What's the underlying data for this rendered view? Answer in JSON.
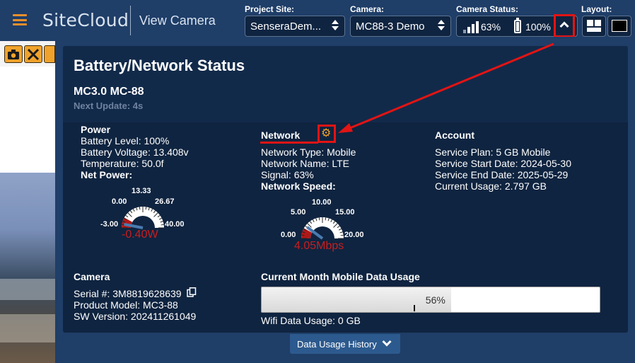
{
  "header": {
    "logo": "SiteCloud",
    "page_title": "View Camera",
    "project_site": {
      "label": "Project Site:",
      "value": "SenseraDem..."
    },
    "camera": {
      "label": "Camera:",
      "value": "MC88-3 Demo"
    },
    "camera_status": {
      "label": "Camera Status:",
      "signal": "63%",
      "battery": "100%"
    },
    "layout": {
      "label": "Layout:"
    }
  },
  "modal": {
    "title": "Battery/Network Status",
    "device": "MC3.0 MC-88",
    "next_update": "Next Update: 4s",
    "power": {
      "heading": "Power",
      "battery_level": "Battery Level: 100%",
      "battery_voltage": "Battery Voltage: 13.408v",
      "temperature": "Temperature: 50.0f",
      "net_power_label": "Net Power:",
      "gauge": {
        "ticks": [
          "-3.00",
          "0.00",
          "13.33",
          "26.67",
          "40.00"
        ],
        "value": -0.4,
        "min": -3.0,
        "max": 40.0,
        "value_text": "-0.40W"
      }
    },
    "network": {
      "heading": "Network",
      "type": "Network Type: Mobile",
      "name": "Network Name: LTE",
      "signal": "Signal: 63%",
      "speed_label": "Network Speed:",
      "gauge": {
        "ticks": [
          "0.00",
          "5.00",
          "10.00",
          "15.00",
          "20.00"
        ],
        "value": 4.05,
        "min": 0.0,
        "max": 20.0,
        "value_text": "4.05Mbps"
      }
    },
    "account": {
      "heading": "Account",
      "plan": "Service Plan: 5 GB Mobile",
      "start": "Service Start Date: 2024-05-30",
      "end": "Service End Date: 2025-05-29",
      "usage": "Current Usage: 2.797 GB"
    },
    "camera": {
      "heading": "Camera",
      "serial": "Serial #: 3M8819628639",
      "model": "Product Model: MC3-88",
      "sw": "SW Version: 202411261049"
    },
    "data_usage": {
      "heading": "Current Month Mobile Data Usage",
      "percent": 56,
      "percent_text": "56%",
      "wifi": "Wifi Data Usage: 0 GB"
    },
    "history_button": "Data Usage History"
  },
  "colors": {
    "accent_orange": "#f0a32c",
    "annotation_red": "#e21414",
    "gauge_value_red": "#c81e1e",
    "panel_bg": "#0f2440"
  }
}
